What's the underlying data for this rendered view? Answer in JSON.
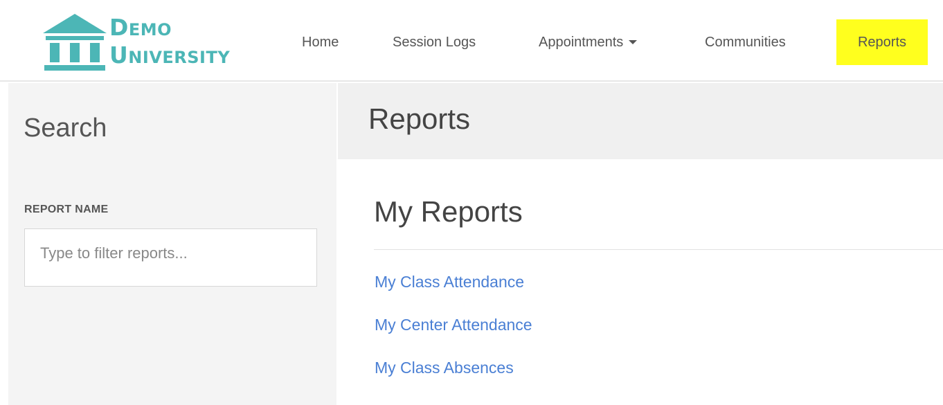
{
  "brand": {
    "line1_initial": "D",
    "line1_rest": "EMO",
    "line2_initial": "U",
    "line2_rest": "NIVERSITY",
    "color": "#4cb6b6",
    "icon": "building-columns-icon"
  },
  "nav": {
    "home": "Home",
    "session_logs": "Session Logs",
    "appointments": "Appointments",
    "communities": "Communities",
    "reports": "Reports",
    "highlight_color": "#ffff1e"
  },
  "sidebar": {
    "title": "Search",
    "field_label": "REPORT NAME",
    "filter_placeholder": "Type to filter reports...",
    "filter_value": ""
  },
  "main": {
    "page_title": "Reports",
    "section_title": "My Reports",
    "reports": [
      "My Class Attendance",
      "My Center Attendance",
      "My Class Absences"
    ],
    "link_color": "#4a7fd4"
  }
}
